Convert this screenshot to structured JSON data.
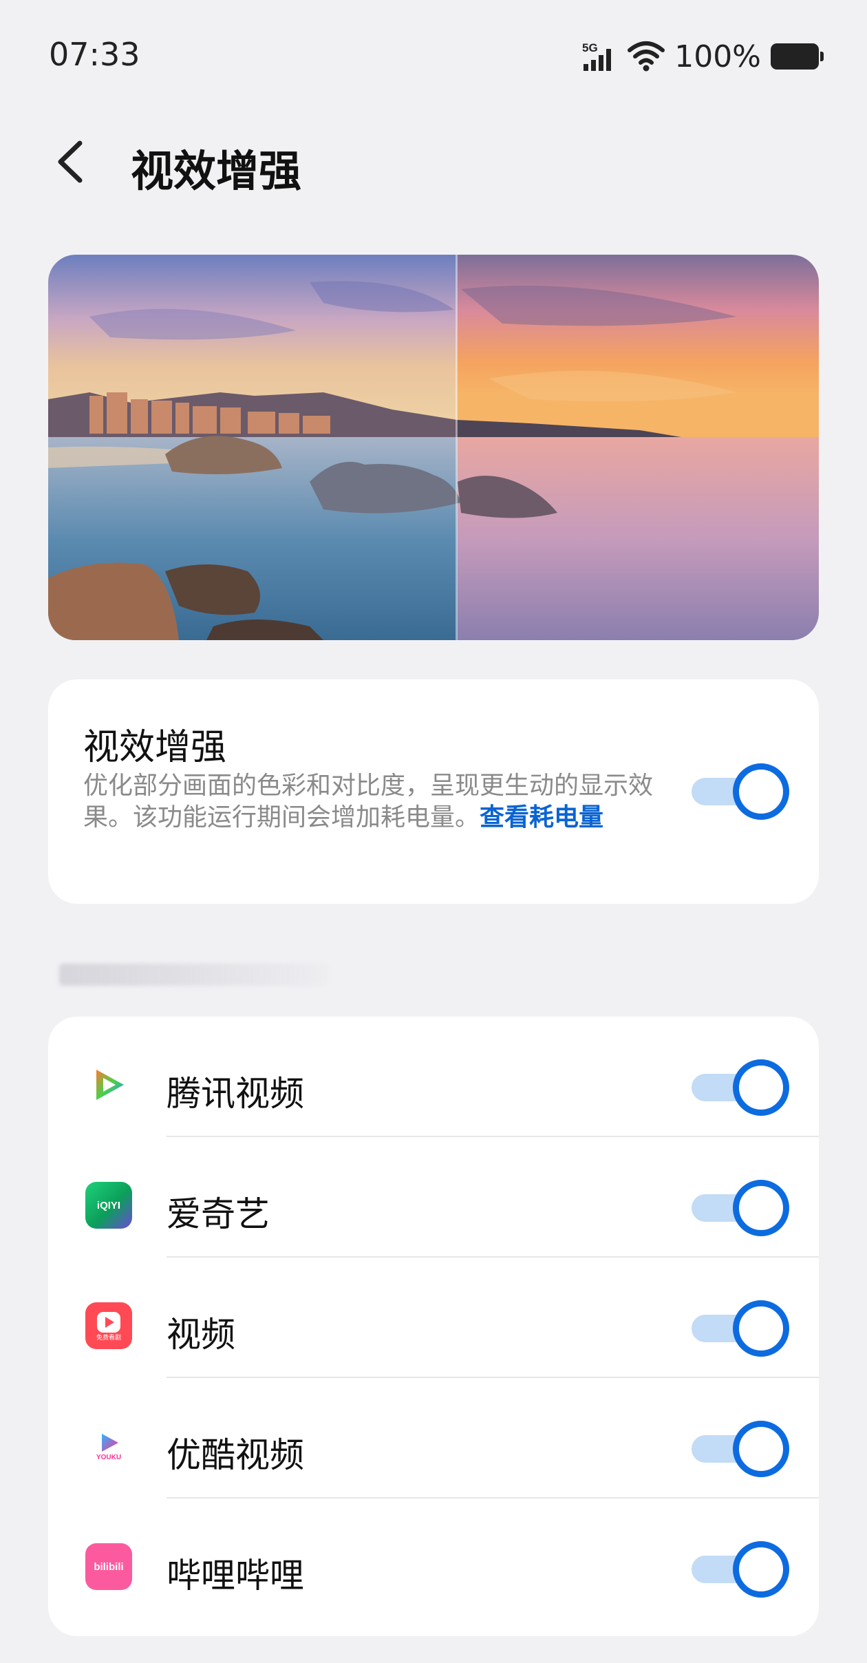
{
  "status_bar": {
    "time": "07:33",
    "network": "5G",
    "battery_percent": "100%"
  },
  "header": {
    "title": "视效增强"
  },
  "main_setting": {
    "title": "视效增强",
    "description": "优化部分画面的色彩和对比度，呈现更生动的显示效果。该功能运行期间会增加耗电量。",
    "link_text": "查看耗电量",
    "enabled": true
  },
  "apps": [
    {
      "name": "腾讯视频",
      "icon": "tencent-video-icon",
      "enabled": true
    },
    {
      "name": "爱奇艺",
      "icon": "iqiyi-icon",
      "icon_text": "iQIYI",
      "enabled": true
    },
    {
      "name": "视频",
      "icon": "video-app-icon",
      "icon_text": "免费看剧",
      "enabled": true
    },
    {
      "name": "优酷视频",
      "icon": "youku-icon",
      "icon_text": "YOUKU",
      "enabled": true
    },
    {
      "name": "哔哩哔哩",
      "icon": "bilibili-icon",
      "icon_text": "bilibili",
      "enabled": true
    }
  ],
  "colors": {
    "accent": "#0d6be0",
    "track": "#c2dbf6",
    "link": "#0a64d2",
    "background": "#f1f1f4"
  }
}
